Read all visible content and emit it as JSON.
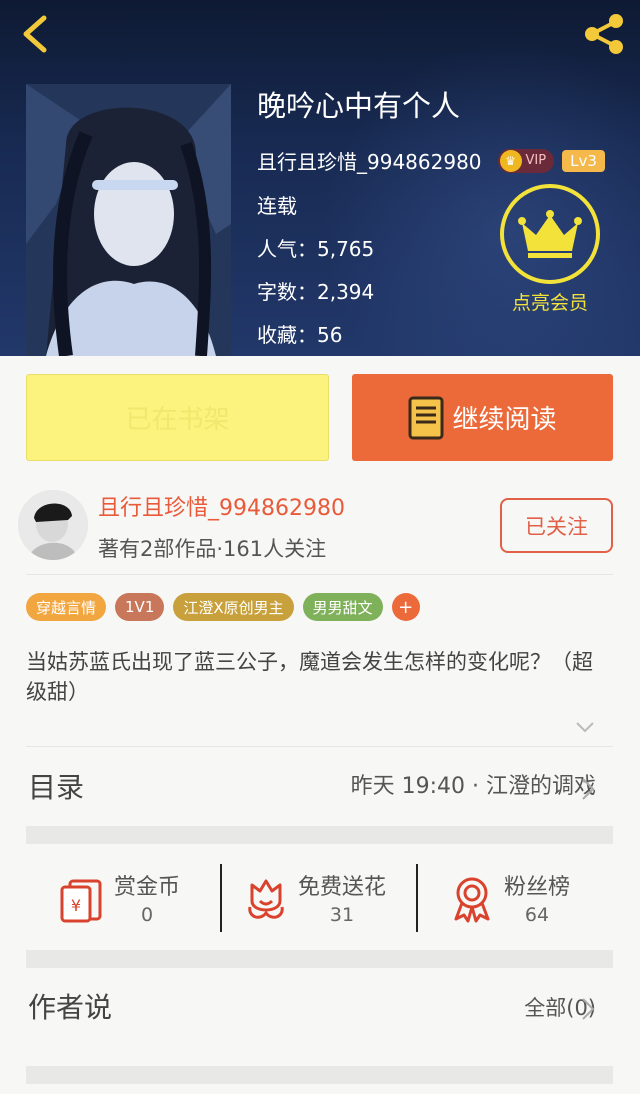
{
  "book": {
    "title": "晚吟心中有个人",
    "author": "且行且珍惜_994862980",
    "vip_badge": "VIP",
    "level_badge": "Lv3",
    "status": "连载",
    "popularity": "人气：5,765",
    "words": "字数：2,394",
    "favorites": "收藏：56",
    "vip_action_label": "点亮会员"
  },
  "actions": {
    "shelf_label": "已在书架",
    "read_label": "继续阅读"
  },
  "author_card": {
    "name": "且行且珍惜_994862980",
    "stats": "著有2部作品·161人关注",
    "follow_label": "已关注"
  },
  "tags": [
    {
      "label": "穿越言情",
      "color": "#f2a640"
    },
    {
      "label": "1V1",
      "color": "#c9775a"
    },
    {
      "label": "江澄X原创男主",
      "color": "#c9a13c"
    },
    {
      "label": "男男甜文",
      "color": "#7fb15a"
    },
    {
      "label": "+",
      "color": "#ec6a3a"
    }
  ],
  "description": "当姑苏蓝氏出现了蓝三公子，魔道会发生怎样的变化呢？（超级甜）",
  "toc": {
    "label": "目录",
    "latest": "昨天 19:40 · 江澄的调戏"
  },
  "stats": [
    {
      "label": "赏金币",
      "value": "0",
      "icon": "red-envelope-icon"
    },
    {
      "label": "免费送花",
      "value": "31",
      "icon": "flower-icon"
    },
    {
      "label": "粉丝榜",
      "value": "64",
      "icon": "medal-icon"
    }
  ],
  "author_says": {
    "label": "作者说",
    "all_label": "全部(0)"
  },
  "colors": {
    "accent": "#ec6a3a",
    "vip_yellow": "#f3e23a",
    "shelf_yellow": "#fbf37e",
    "icon_red": "#d9432e"
  }
}
